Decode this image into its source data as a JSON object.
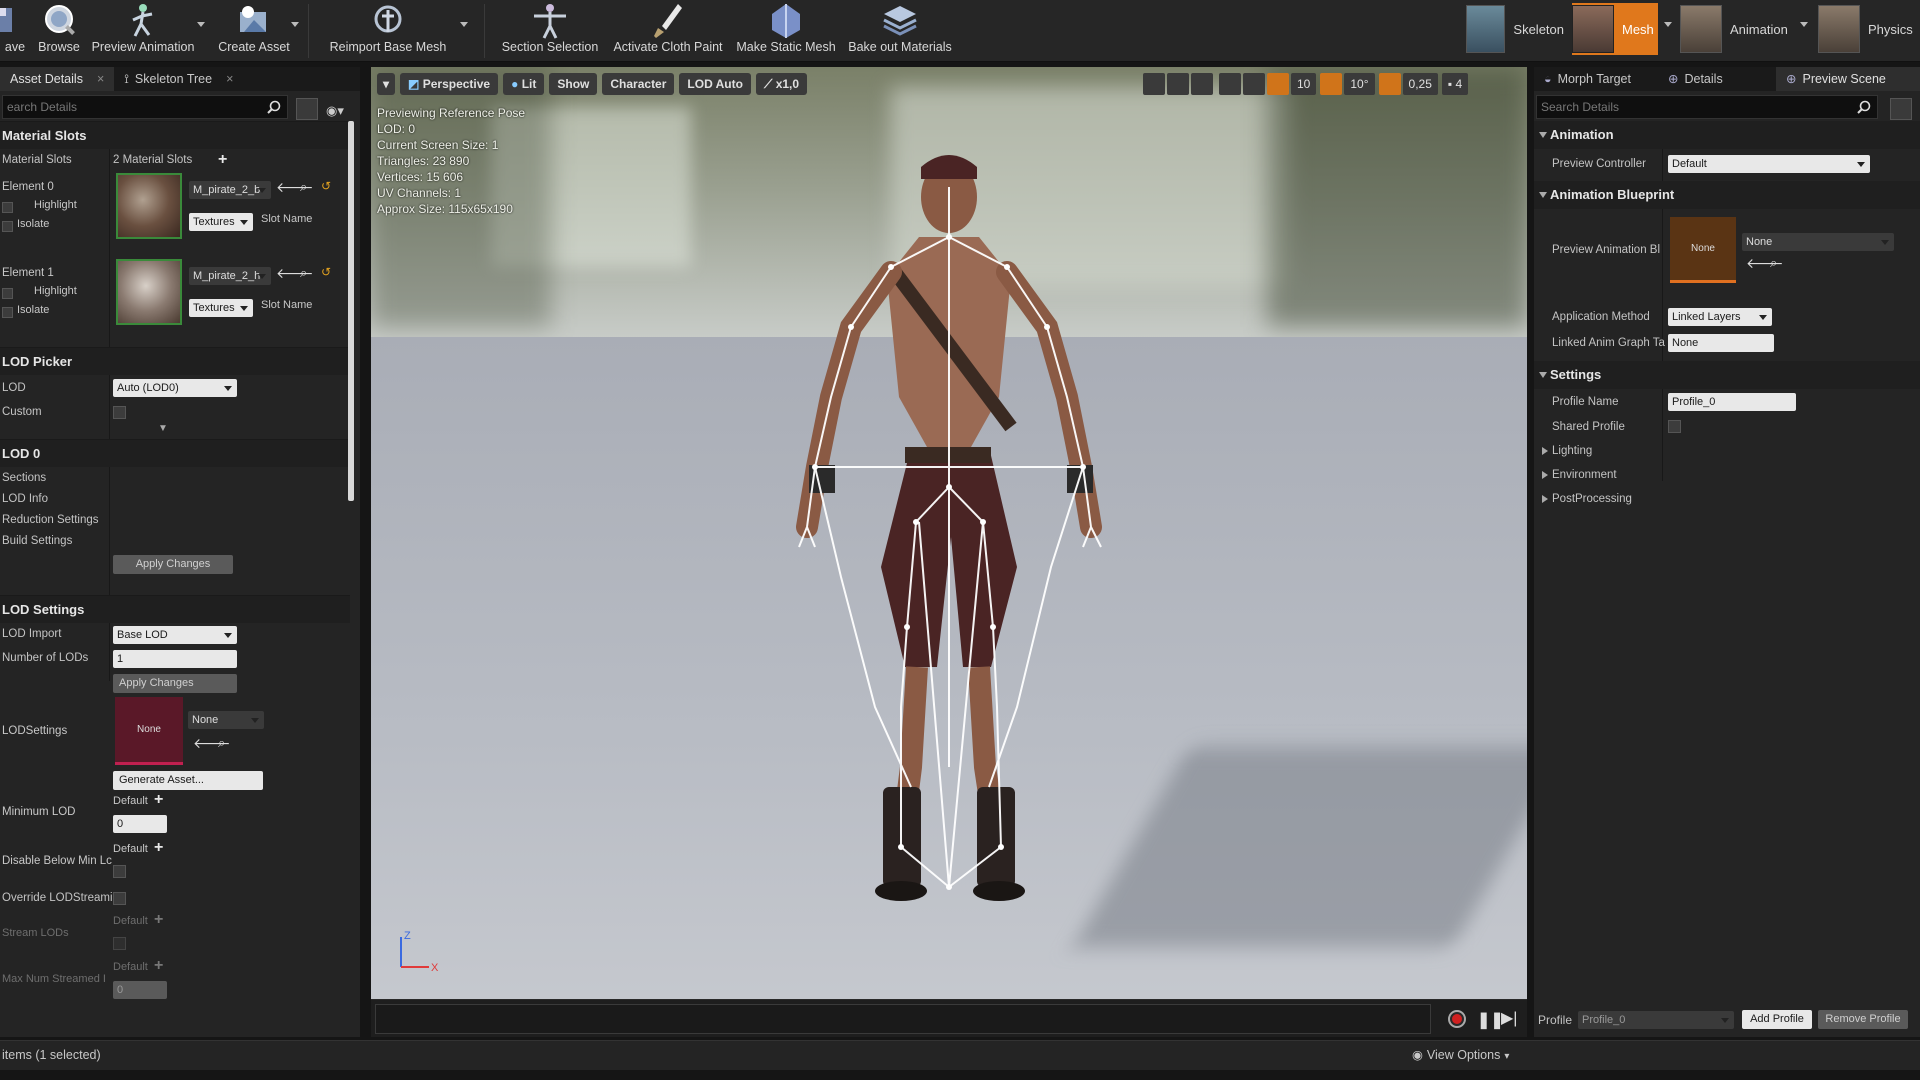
{
  "toolbar": {
    "save": "ave",
    "browse": "Browse",
    "preview_animation": "Preview Animation",
    "create_asset": "Create Asset",
    "reimport_base_mesh": "Reimport Base Mesh",
    "section_selection": "Section Selection",
    "activate_cloth_paint": "Activate Cloth Paint",
    "make_static_mesh": "Make Static Mesh",
    "bake_out_materials": "Bake out Materials",
    "modes": {
      "skeleton": "Skeleton",
      "mesh": "Mesh",
      "animation": "Animation",
      "physics": "Physics"
    }
  },
  "left_panel": {
    "tabs": {
      "asset_details": "Asset Details",
      "skeleton_tree": "Skeleton Tree"
    },
    "search_placeholder": "earch Details",
    "material_slots": {
      "header": "Material Slots",
      "label": "Material Slots",
      "count": "2 Material Slots",
      "elements": [
        {
          "name": "Element 0",
          "highlight": "Highlight",
          "isolate": "Isolate",
          "material": "M_pirate_2_b",
          "textures": "Textures",
          "slot_name": "Slot Name"
        },
        {
          "name": "Element 1",
          "highlight": "Highlight",
          "isolate": "Isolate",
          "material": "M_pirate_2_h",
          "textures": "Textures",
          "slot_name": "Slot Name"
        }
      ]
    },
    "lod_picker": {
      "header": "LOD Picker",
      "lod_label": "LOD",
      "lod_value": "Auto (LOD0)",
      "custom_label": "Custom"
    },
    "lod0": {
      "header": "LOD 0",
      "sections": "Sections",
      "lod_info": "LOD Info",
      "reduction_settings": "Reduction Settings",
      "build_settings": "Build Settings",
      "apply_changes": "Apply Changes"
    },
    "lod_settings": {
      "header": "LOD Settings",
      "lod_import_label": "LOD Import",
      "lod_import_value": "Base LOD",
      "num_lods_label": "Number of LODs",
      "num_lods_value": "1",
      "apply_changes": "Apply Changes",
      "lodsettings_label": "LODSettings",
      "lodsettings_thumb": "None",
      "lodsettings_value": "None",
      "generate_asset": "Generate Asset...",
      "min_lod_label": "Minimum LOD",
      "min_lod_default": "Default",
      "min_lod_value": "0",
      "disable_below_label": "Disable Below Min Lc",
      "disable_below_default": "Default",
      "override_label": "Override LODStreami",
      "stream_lods_label": "Stream LODs",
      "stream_lods_default": "Default",
      "max_num_label": "Max Num Streamed I",
      "max_num_default": "Default",
      "max_num_value": "0"
    }
  },
  "viewport": {
    "perspective": "Perspective",
    "lit": "Lit",
    "show": "Show",
    "character": "Character",
    "lod_auto": "LOD Auto",
    "speed": "x1,0",
    "grid_snap": "10",
    "rot_snap": "10°",
    "scale_snap": "0,25",
    "cam_speed": "4",
    "info": [
      "Previewing Reference Pose",
      "LOD: 0",
      "Current Screen Size: 1",
      "Triangles: 23 890",
      "Vertices: 15 606",
      "UV Channels: 1",
      "Approx Size: 115x65x190"
    ],
    "axis_z": "Z",
    "axis_x": "X"
  },
  "right_panel": {
    "tabs": {
      "morph_target": "Morph Target",
      "details": "Details",
      "preview_scene": "Preview Scene"
    },
    "search_placeholder": "Search Details",
    "animation": {
      "header": "Animation",
      "preview_controller_label": "Preview Controller",
      "preview_controller_value": "Default"
    },
    "anim_blueprint": {
      "header": "Animation Blueprint",
      "preview_anim_label": "Preview Animation Bl",
      "thumb": "None",
      "preview_anim_value": "None",
      "app_method_label": "Application Method",
      "app_method_value": "Linked Layers",
      "linked_label": "Linked Anim Graph Ta",
      "linked_value": "None"
    },
    "settings": {
      "header": "Settings",
      "profile_name_label": "Profile Name",
      "profile_name_value": "Profile_0",
      "shared_profile_label": "Shared Profile",
      "lighting": "Lighting",
      "environment": "Environment",
      "postprocessing": "PostProcessing"
    },
    "footer": {
      "profile_label": "Profile",
      "profile_value": "Profile_0",
      "add_profile": "Add Profile",
      "remove_profile": "Remove Profile"
    }
  },
  "status_bar": {
    "items": "items (1 selected)",
    "view_options": "View Options"
  },
  "colors": {
    "accent_orange": "#e0781c",
    "panel": "#242424",
    "header": "#1f1f1f",
    "input": "#e8e8e8"
  }
}
